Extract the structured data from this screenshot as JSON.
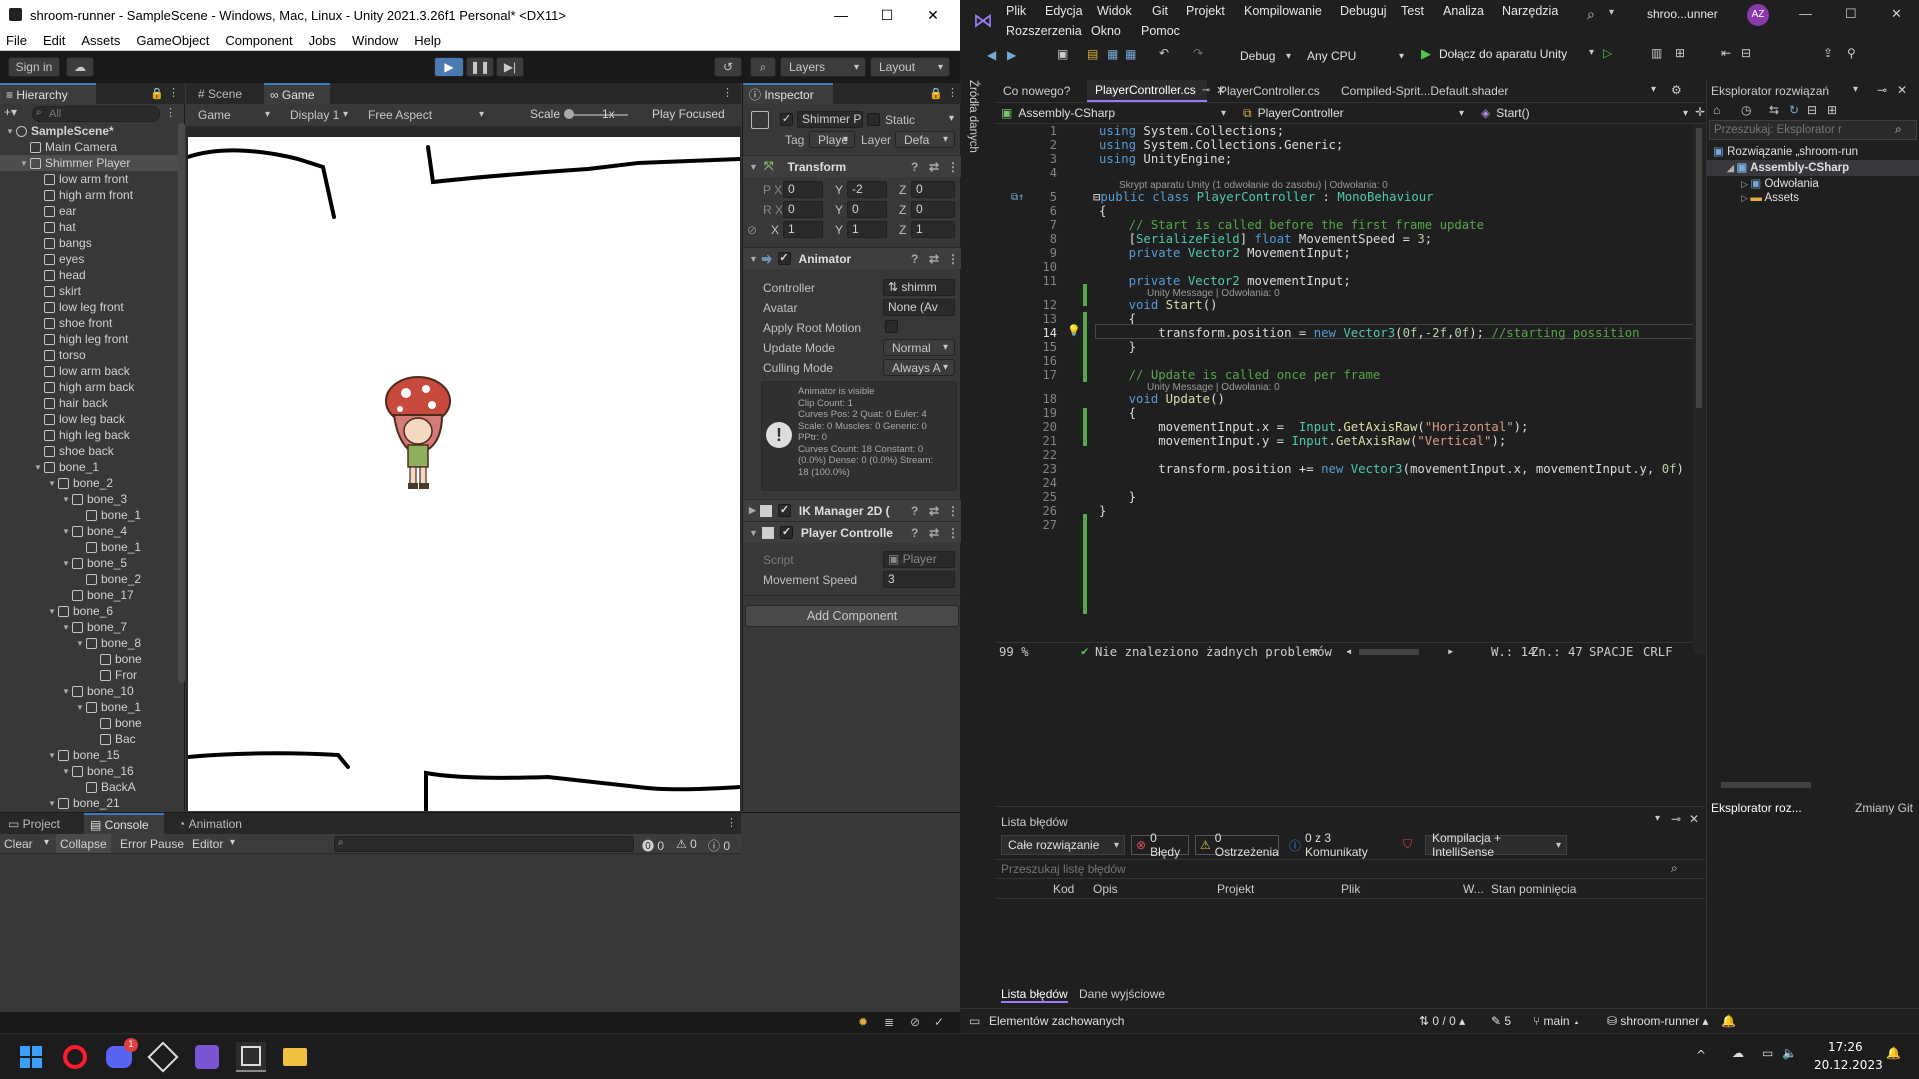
{
  "unity": {
    "title": "shroom-runner - SampleScene - Windows, Mac, Linux - Unity 2021.3.26f1 Personal* <DX11>",
    "menu": [
      "File",
      "Edit",
      "Assets",
      "GameObject",
      "Component",
      "Jobs",
      "Window",
      "Help"
    ],
    "toolbar": {
      "sign_in": "Sign in",
      "layers": "Layers",
      "layout": "Layout"
    },
    "hierarchy": {
      "tab": "Hierarchy",
      "search_placeholder": "All",
      "rows": [
        {
          "label": "SampleScene*",
          "indent": 0,
          "tri": "▼",
          "scene": true
        },
        {
          "label": "Main Camera",
          "indent": 1,
          "tri": ""
        },
        {
          "label": "Shimmer Player",
          "indent": 1,
          "tri": "▼",
          "selected": true
        },
        {
          "label": "low arm front",
          "indent": 2,
          "tri": ""
        },
        {
          "label": "high arm front",
          "indent": 2,
          "tri": ""
        },
        {
          "label": "ear",
          "indent": 2,
          "tri": ""
        },
        {
          "label": "hat",
          "indent": 2,
          "tri": ""
        },
        {
          "label": "bangs",
          "indent": 2,
          "tri": ""
        },
        {
          "label": "eyes",
          "indent": 2,
          "tri": ""
        },
        {
          "label": "head",
          "indent": 2,
          "tri": ""
        },
        {
          "label": "skirt",
          "indent": 2,
          "tri": ""
        },
        {
          "label": "low leg front",
          "indent": 2,
          "tri": ""
        },
        {
          "label": "shoe front",
          "indent": 2,
          "tri": ""
        },
        {
          "label": "high leg front",
          "indent": 2,
          "tri": ""
        },
        {
          "label": "torso",
          "indent": 2,
          "tri": ""
        },
        {
          "label": "low arm back",
          "indent": 2,
          "tri": ""
        },
        {
          "label": "high arm back",
          "indent": 2,
          "tri": ""
        },
        {
          "label": "hair back",
          "indent": 2,
          "tri": ""
        },
        {
          "label": "low leg back",
          "indent": 2,
          "tri": ""
        },
        {
          "label": "high leg back",
          "indent": 2,
          "tri": ""
        },
        {
          "label": "shoe back",
          "indent": 2,
          "tri": ""
        },
        {
          "label": "bone_1",
          "indent": 2,
          "tri": "▼"
        },
        {
          "label": "bone_2",
          "indent": 3,
          "tri": "▼"
        },
        {
          "label": "bone_3",
          "indent": 4,
          "tri": "▼"
        },
        {
          "label": "bone_1",
          "indent": 5,
          "tri": ""
        },
        {
          "label": "bone_4",
          "indent": 4,
          "tri": "▼"
        },
        {
          "label": "bone_1",
          "indent": 5,
          "tri": ""
        },
        {
          "label": "bone_5",
          "indent": 4,
          "tri": "▼"
        },
        {
          "label": "bone_2",
          "indent": 5,
          "tri": ""
        },
        {
          "label": "bone_17",
          "indent": 4,
          "tri": ""
        },
        {
          "label": "bone_6",
          "indent": 3,
          "tri": "▼"
        },
        {
          "label": "bone_7",
          "indent": 4,
          "tri": "▼"
        },
        {
          "label": "bone_8",
          "indent": 5,
          "tri": "▼"
        },
        {
          "label": "bone",
          "indent": 6,
          "tri": ""
        },
        {
          "label": "Fror",
          "indent": 6,
          "tri": ""
        },
        {
          "label": "bone_10",
          "indent": 4,
          "tri": "▼"
        },
        {
          "label": "bone_1",
          "indent": 5,
          "tri": "▼"
        },
        {
          "label": "bone",
          "indent": 6,
          "tri": ""
        },
        {
          "label": "Bac",
          "indent": 6,
          "tri": ""
        },
        {
          "label": "bone_15",
          "indent": 3,
          "tri": "▼"
        },
        {
          "label": "bone_16",
          "indent": 4,
          "tri": "▼"
        },
        {
          "label": "BackA",
          "indent": 5,
          "tri": ""
        },
        {
          "label": "bone_21",
          "indent": 3,
          "tri": "▼"
        }
      ]
    },
    "game": {
      "tabs": [
        "Scene",
        "Game"
      ],
      "display_mode": "Game",
      "display": "Display 1",
      "aspect": "Free Aspect",
      "scale_label": "Scale",
      "scale_value": "1x",
      "play_focused": "Play Focused"
    },
    "inspector": {
      "tab": "Inspector",
      "object_name": "Shimmer P",
      "static_label": "Static",
      "tag_label": "Tag",
      "tag_value": "Playe",
      "layer_label": "Layer",
      "layer_value": "Defa",
      "transform": {
        "title": "Transform",
        "pos": {
          "x": "0",
          "y": "-2",
          "z": "0"
        },
        "rot": {
          "x": "0",
          "y": "0",
          "z": "0"
        },
        "scale": {
          "x": "1",
          "y": "1",
          "z": "1"
        }
      },
      "animator": {
        "title": "Animator",
        "controller_label": "Controller",
        "controller_value": "shimm",
        "avatar_label": "Avatar",
        "avatar_value": "None (Av",
        "apply_root_label": "Apply Root Motion",
        "update_mode_label": "Update Mode",
        "update_mode_value": "Normal",
        "culling_label": "Culling Mode",
        "culling_value": "Always A",
        "info": "Animator is visible\nClip Count: 1\nCurves Pos: 2 Quat: 0 Euler: 4\nScale: 0 Muscles: 0 Generic: 0\nPPtr: 0\nCurves Count: 18 Constant: 0\n(0.0%) Dense: 0 (0.0%) Stream:\n18 (100.0%)"
      },
      "ik_manager": "IK Manager 2D (",
      "player_controller": {
        "title": "Player Controlle",
        "script_label": "Script",
        "script_value": "Player",
        "speed_label": "Movement Speed",
        "speed_value": "3"
      },
      "add_component": "Add Component"
    },
    "bottom": {
      "tabs": [
        "Project",
        "Console",
        "Animation"
      ],
      "clear": "Clear",
      "collapse": "Collapse",
      "error_pause": "Error Pause",
      "editor": "Editor",
      "counts": [
        "0",
        "0",
        "0"
      ]
    }
  },
  "vs": {
    "menu_row1": [
      "Plik",
      "Edycja",
      "Widok",
      "Git",
      "Projekt",
      "Kompilowanie",
      "Debuguj",
      "Test",
      "Analiza",
      "Narzędzia"
    ],
    "menu_row2": [
      "Rozszerzenia",
      "Okno",
      "Pomoc"
    ],
    "solution_name": "shroo...unner",
    "avatar": "AZ",
    "config": "Debug",
    "platform": "Any CPU",
    "attach": "Dołącz do aparatu Unity",
    "side_label": "Źródła danych",
    "tabs": [
      "Co nowego?",
      "PlayerController.cs",
      "PlayerController.cs",
      "Compiled-Sprit...Default.shader"
    ],
    "nav": {
      "project": "Assembly-CSharp",
      "class": "PlayerController",
      "member": "Start()"
    },
    "lens_class": "Skrypt aparatu Unity (1 odwołanie do zasobu) | Odwołania: 0",
    "lens_method": "Unity Message | Odwołania: 0",
    "code_lines": [
      "1",
      "2",
      "3",
      "4",
      "5",
      "6",
      "7",
      "8",
      "9",
      "10",
      "11",
      "12",
      "13",
      "14",
      "15",
      "16",
      "17",
      "18",
      "19",
      "20",
      "21",
      "22",
      "23",
      "24",
      "25",
      "26",
      "27"
    ],
    "status": {
      "zoom": "99 %",
      "problems": "Nie znaleziono żadnych problemów",
      "line": "W.: 14",
      "col": "Zn.: 47",
      "spaces": "SPACJE",
      "crlf": "CRLF"
    },
    "errors": {
      "title": "Lista błędów",
      "scope": "Całe rozwiązanie",
      "errors_btn": "0 Błędy",
      "warnings_btn": "0 Ostrzeżenia",
      "messages_btn": "0 z 3 Komunikaty",
      "build": "Kompilacja + IntelliSense",
      "search": "Przeszukaj listę błędów",
      "columns": [
        "Kod",
        "Opis",
        "Projekt",
        "Plik",
        "W...",
        "Stan pominięcia"
      ],
      "bottom_tabs": [
        "Lista błędów",
        "Dane wyjściowe"
      ]
    },
    "solution": {
      "title": "Eksplorator rozwiązań",
      "search": "Przeszukaj: Eksplorator r",
      "items": [
        {
          "label": "Rozwiązanie „shroom-run",
          "indent": 0
        },
        {
          "label": "Assembly-CSharp",
          "indent": 1,
          "bold": true
        },
        {
          "label": "Odwołania",
          "indent": 2
        },
        {
          "label": "Assets",
          "indent": 2
        }
      ],
      "bottom_tabs": [
        "Eksplorator roz...",
        "Zmiany Git"
      ]
    },
    "statusbar": {
      "saved": "Elementów zachowanych",
      "updown": "0 / 0",
      "pen": "5",
      "branch": "main",
      "repo": "shroom-runner"
    }
  },
  "taskbar": {
    "time": "17:26",
    "date": "20.12.2023",
    "discord_badge": "1"
  },
  "colors": {
    "unity_bg": "#383838",
    "vs_bg": "#1f1f1f",
    "accent_purple": "#9b7bf5",
    "play_blue": "#3a79bb"
  }
}
